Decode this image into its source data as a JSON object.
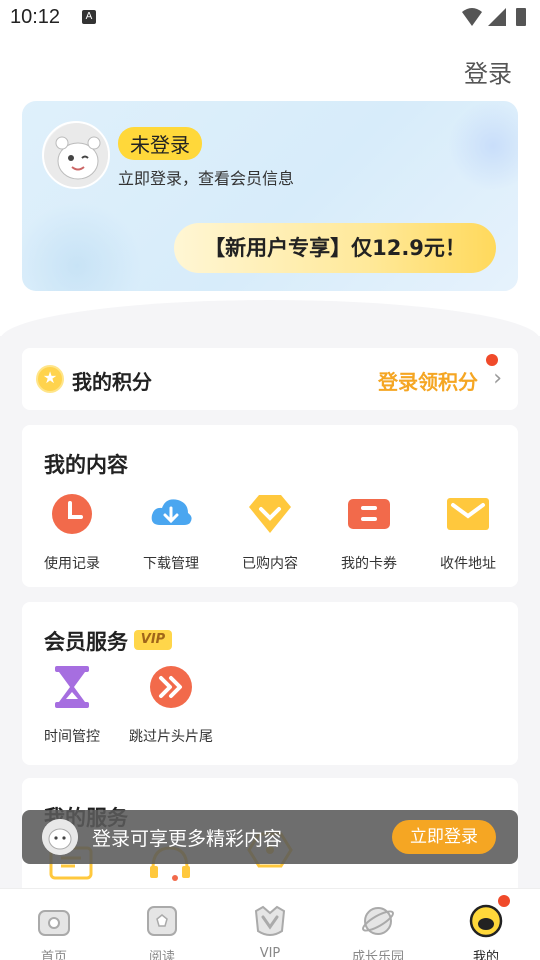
{
  "status_bar": {
    "time": "10:12",
    "a_icon": "A"
  },
  "header": {
    "login_link": "登录"
  },
  "member_card": {
    "status_badge": "未登录",
    "subtitle": "立即登录，查看会员信息",
    "promo": "【新用户专享】仅12.9元！"
  },
  "points": {
    "title": "我的积分",
    "action": "登录领积分",
    "chevron": "›"
  },
  "my_content": {
    "title": "我的内容",
    "items": [
      {
        "label": "使用记录",
        "icon": "clock-icon"
      },
      {
        "label": "下载管理",
        "icon": "cloud-download-icon"
      },
      {
        "label": "已购内容",
        "icon": "purchased-icon"
      },
      {
        "label": "我的卡券",
        "icon": "coupon-icon"
      },
      {
        "label": "收件地址",
        "icon": "envelope-icon"
      }
    ]
  },
  "member_services": {
    "title": "会员服务",
    "vip_tag": "VIP",
    "items": [
      {
        "label": "时间管控",
        "icon": "hourglass-icon"
      },
      {
        "label": "跳过片头片尾",
        "icon": "skip-forward-icon"
      }
    ]
  },
  "my_services": {
    "title": "我的服务"
  },
  "toast": {
    "message": "登录可享更多精彩内容",
    "button": "立即登录"
  },
  "tabbar": {
    "tabs": [
      {
        "label": "首页",
        "icon": "tv-icon"
      },
      {
        "label": "阅读",
        "icon": "book-icon"
      },
      {
        "label": "VIP",
        "icon": "vip-crown-icon"
      },
      {
        "label": "成长乐园",
        "icon": "planet-icon"
      },
      {
        "label": "我的",
        "icon": "profile-face-icon"
      }
    ],
    "active_index": 4
  },
  "colors": {
    "accent": "#f5a623",
    "badge_yellow": "#ffd83a",
    "notification_red": "#f04a2a",
    "card_blue": "#dff0fb"
  }
}
